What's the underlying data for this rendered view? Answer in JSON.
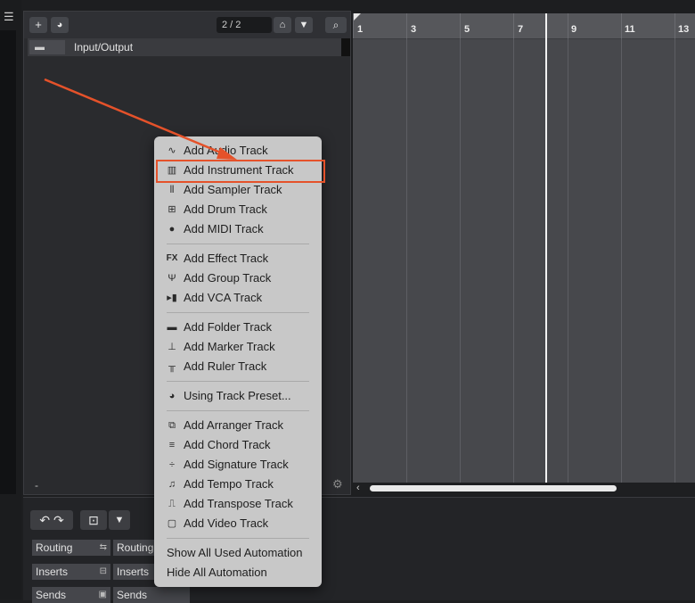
{
  "toolbar": {
    "counter": "2 / 2",
    "add_icon": "plus-icon",
    "preset_icon": "track-preset-icon",
    "visibility_icon": "visibility-icon",
    "filter_icon": "filter-icon",
    "search_icon": "search-icon"
  },
  "track_list": {
    "tracks": [
      {
        "name": "Input/Output"
      }
    ],
    "bottom_dash": "-"
  },
  "ruler": {
    "bars": [
      "1",
      "3",
      "5",
      "7",
      "9",
      "11",
      "13"
    ]
  },
  "lower_zone": {
    "undo_icon": "undo-icon",
    "redo_icon": "redo-icon",
    "camera_icon": "camera-icon",
    "dropdown_icon": "dropdown-arrow-icon",
    "col1": [
      "Routing",
      "Inserts",
      "Sends"
    ],
    "col2": [
      "Routing",
      "Inserts",
      "Sends"
    ]
  },
  "context_menu": {
    "items": [
      {
        "label": "Add Audio Track",
        "icon": "audio-wave-icon"
      },
      {
        "label": "Add Instrument Track",
        "icon": "keyboard-icon"
      },
      {
        "label": "Add Sampler Track",
        "icon": "sampler-icon"
      },
      {
        "label": "Add Drum Track",
        "icon": "drum-grid-icon"
      },
      {
        "label": "Add MIDI Track",
        "icon": "midi-icon"
      },
      {
        "label": "Add Effect Track",
        "icon": "fx-icon"
      },
      {
        "label": "Add Group Track",
        "icon": "group-icon"
      },
      {
        "label": "Add VCA Track",
        "icon": "vca-icon"
      },
      {
        "label": "Add Folder Track",
        "icon": "folder-icon"
      },
      {
        "label": "Add Marker Track",
        "icon": "marker-icon"
      },
      {
        "label": "Add Ruler Track",
        "icon": "ruler-icon"
      },
      {
        "label": "Using Track Preset...",
        "icon": "track-preset-icon"
      },
      {
        "label": "Add Arranger Track",
        "icon": "arranger-icon"
      },
      {
        "label": "Add Chord Track",
        "icon": "chord-icon"
      },
      {
        "label": "Add Signature Track",
        "icon": "signature-icon"
      },
      {
        "label": "Add Tempo Track",
        "icon": "tempo-icon"
      },
      {
        "label": "Add Transpose Track",
        "icon": "transpose-icon"
      },
      {
        "label": "Add Video Track",
        "icon": "video-icon"
      },
      {
        "label": "Show All Used Automation"
      },
      {
        "label": "Hide All Automation"
      }
    ]
  },
  "colors": {
    "highlight": "#e5522a",
    "menu_bg": "#c8c8c8",
    "arranger_bg": "#47484c"
  }
}
